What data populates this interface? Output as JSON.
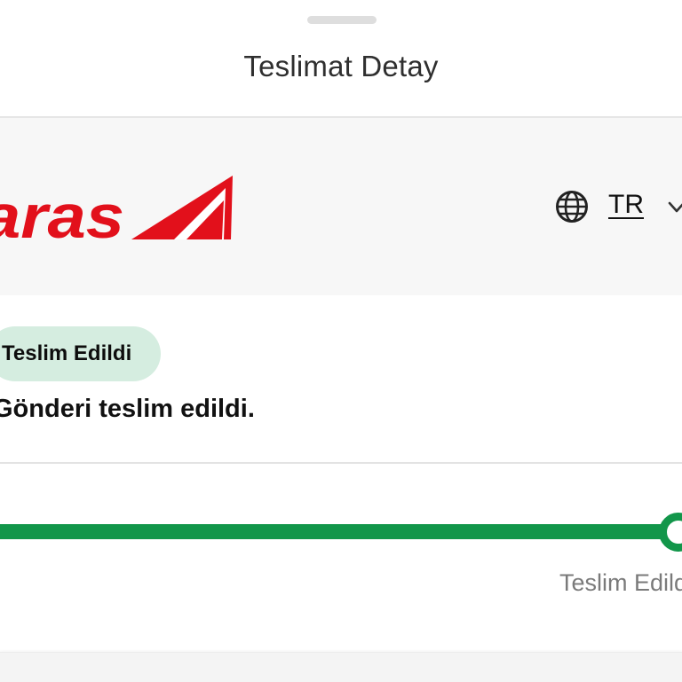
{
  "sheet": {
    "title": "Teslimat Detay"
  },
  "brand": {
    "logo_text": "aras",
    "logo_color": "#e2101b"
  },
  "language": {
    "code": "TR",
    "icon": "globe-icon",
    "dropdown_icon": "chevron-down-icon"
  },
  "status": {
    "badge_label": "Teslim Edildi",
    "message": "Gönderi teslim edildi.",
    "badge_color": "#d5ede0"
  },
  "progress": {
    "current_step_label": "Teslim Edildi",
    "fraction": 1.0,
    "color": "#12964a"
  }
}
